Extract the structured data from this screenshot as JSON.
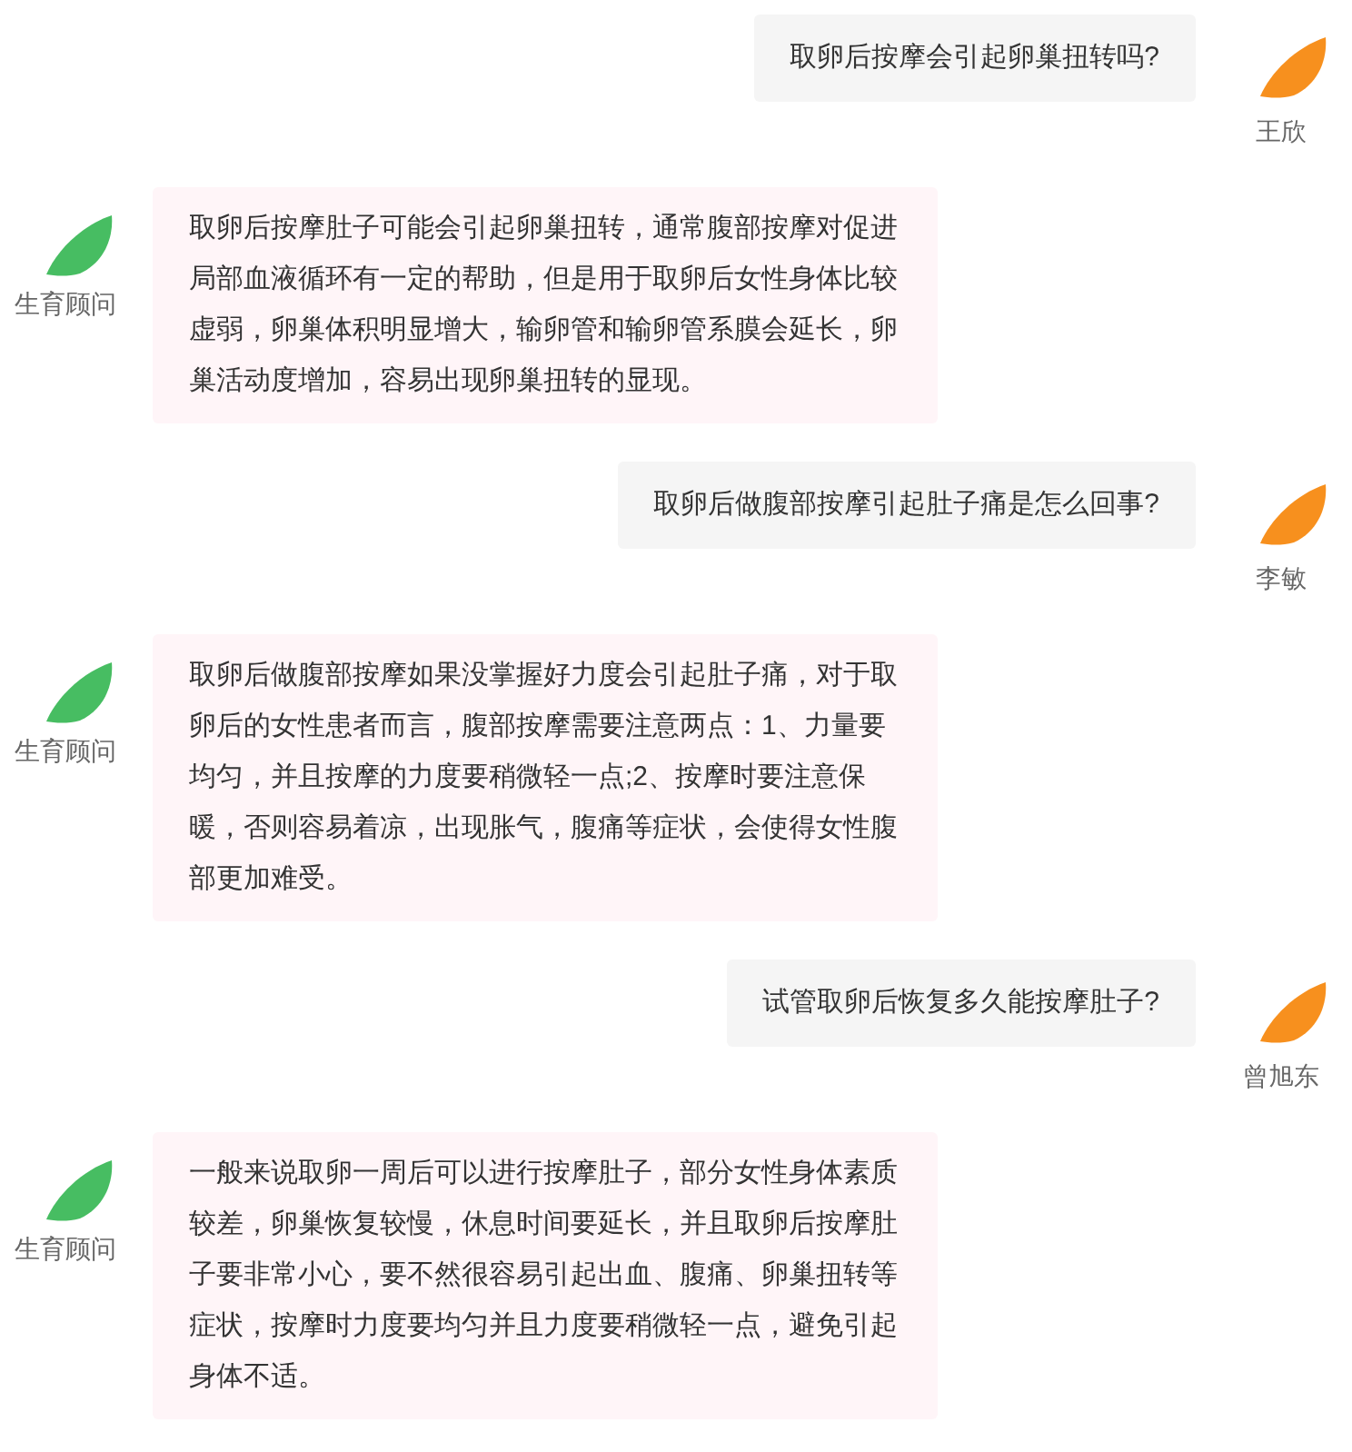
{
  "messages": [
    {
      "kind": "question",
      "sender": "王欣",
      "text": "取卵后按摩会引起卵巢扭转吗?"
    },
    {
      "kind": "answer",
      "sender": "生育顾问",
      "text": "取卵后按摩肚子可能会引起卵巢扭转，通常腹部按摩对促进局部血液循环有一定的帮助，但是用于取卵后女性身体比较虚弱，卵巢体积明显增大，输卵管和输卵管系膜会延长，卵巢活动度增加，容易出现卵巢扭转的显现。"
    },
    {
      "kind": "question",
      "sender": "李敏",
      "text": "取卵后做腹部按摩引起肚子痛是怎么回事?"
    },
    {
      "kind": "answer",
      "sender": "生育顾问",
      "text": "取卵后做腹部按摩如果没掌握好力度会引起肚子痛，对于取卵后的女性患者而言，腹部按摩需要注意两点：1、力量要均匀，并且按摩的力度要稍微轻一点;2、按摩时要注意保暖，否则容易着凉，出现胀气，腹痛等症状，会使得女性腹部更加难受。"
    },
    {
      "kind": "question",
      "sender": "曾旭东",
      "text": "试管取卵后恢复多久能按摩肚子?"
    },
    {
      "kind": "answer",
      "sender": "生育顾问",
      "text": "一般来说取卵一周后可以进行按摩肚子，部分女性身体素质较差，卵巢恢复较慢，休息时间要延长，并且取卵后按摩肚子要非常小心，要不然很容易引起出血、腹痛、卵巢扭转等症状，按摩时力度要均匀并且力度要稍微轻一点，避免引起身体不适。"
    }
  ]
}
